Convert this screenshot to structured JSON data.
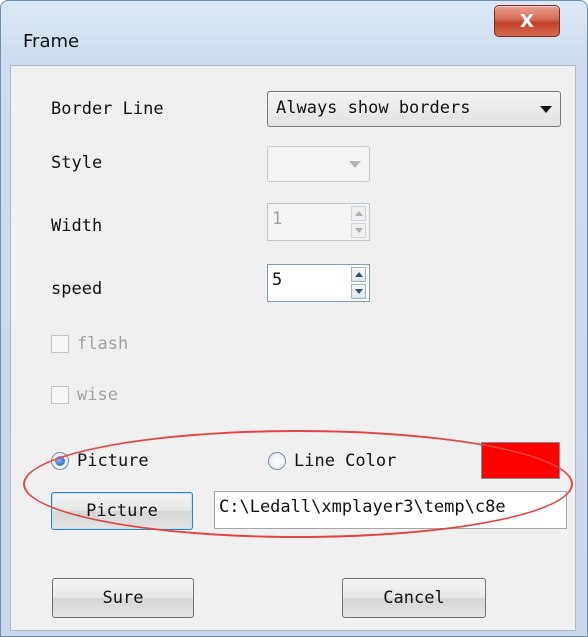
{
  "window": {
    "title": "Frame",
    "close_label": "X"
  },
  "border_line": {
    "label": "Border Line",
    "value": "Always show borders"
  },
  "style": {
    "label": "Style",
    "value": ""
  },
  "width": {
    "label": "Width",
    "value": "1"
  },
  "speed": {
    "label": "speed",
    "value": "5"
  },
  "flash": {
    "label": "flash",
    "checked": false
  },
  "wise": {
    "label": "wise",
    "checked": false
  },
  "mode": {
    "picture_label": "Picture",
    "line_color_label": "Line Color",
    "selected": "Picture",
    "line_color": "#ff0000"
  },
  "picture": {
    "button_label": "Picture",
    "path": "C:\\Ledall\\xmplayer3\\temp\\c8e"
  },
  "actions": {
    "sure_label": "Sure",
    "cancel_label": "Cancel"
  }
}
